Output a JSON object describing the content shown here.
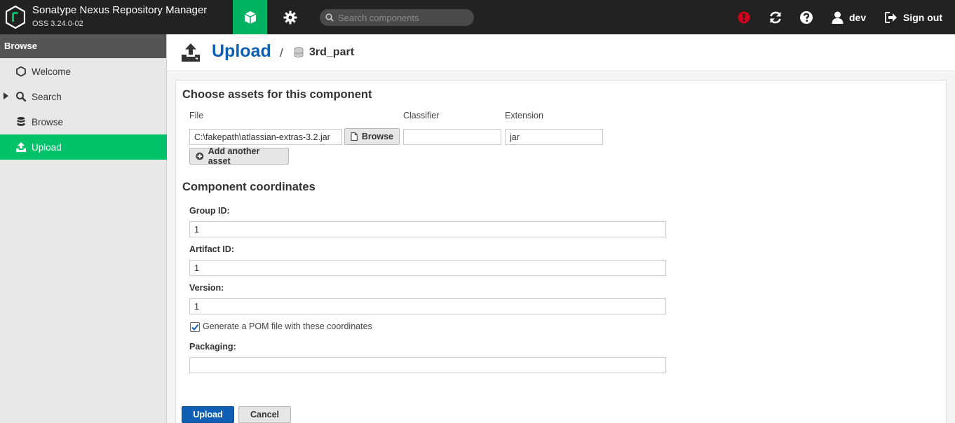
{
  "app": {
    "name": "Sonatype Nexus Repository Manager",
    "version": "OSS 3.24.0-02"
  },
  "header": {
    "search_placeholder": "Search components",
    "user": "dev",
    "signout_label": "Sign out"
  },
  "sidebar": {
    "title": "Browse",
    "items": [
      {
        "label": "Welcome",
        "icon": "hexagon-icon"
      },
      {
        "label": "Search",
        "icon": "search-icon"
      },
      {
        "label": "Browse",
        "icon": "database-icon"
      },
      {
        "label": "Upload",
        "icon": "upload-icon",
        "active": true
      }
    ]
  },
  "page": {
    "title": "Upload",
    "separator": "/",
    "repository": "3rd_part"
  },
  "assets": {
    "section_title": "Choose assets for this component",
    "col_file": "File",
    "col_classifier": "Classifier",
    "col_extension": "Extension",
    "file_value": "C:\\fakepath\\atlassian-extras-3.2.jar",
    "browse_label": "Browse",
    "classifier_value": "",
    "extension_value": "jar",
    "add_asset_label": "Add another asset"
  },
  "coordinates": {
    "section_title": "Component coordinates",
    "group_label": "Group ID:",
    "group_value": "1",
    "artifact_label": "Artifact ID:",
    "artifact_value": "1",
    "version_label": "Version:",
    "version_value": "1",
    "generate_pom_label": "Generate a POM file with these coordinates",
    "generate_pom_checked": true,
    "packaging_label": "Packaging:",
    "packaging_value": ""
  },
  "actions": {
    "upload_label": "Upload",
    "cancel_label": "Cancel"
  },
  "colors": {
    "header_bg": "#222222",
    "accent_green": "#00c268",
    "primary_blue": "#0f5fb5",
    "alert_red": "#d0021b"
  }
}
